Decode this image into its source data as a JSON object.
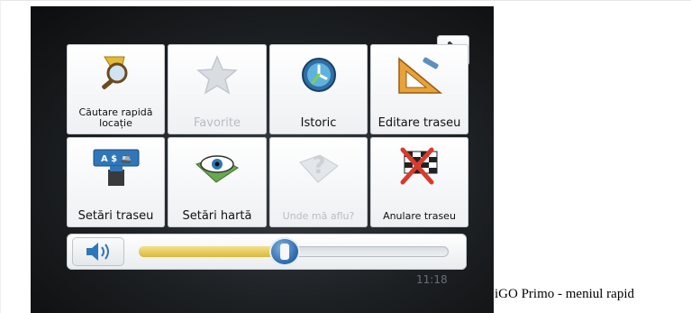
{
  "menu": {
    "tiles": [
      {
        "label": "Căutare rapidă locație",
        "icon": "search-pin-icon",
        "disabled": false
      },
      {
        "label": "Favorite",
        "icon": "star-icon",
        "disabled": true
      },
      {
        "label": "Istoric",
        "icon": "clock-icon",
        "disabled": false
      },
      {
        "label": "Editare traseu",
        "icon": "set-square-icon",
        "disabled": false
      },
      {
        "label": "Setări traseu",
        "icon": "route-settings-icon",
        "disabled": false
      },
      {
        "label": "Setări hartă",
        "icon": "map-eye-icon",
        "disabled": false
      },
      {
        "label": "Unde mă aflu?",
        "icon": "question-map-icon",
        "disabled": true
      },
      {
        "label": "Anulare traseu",
        "icon": "checkered-flag-icon",
        "disabled": false
      }
    ],
    "volume": {
      "level": 0.47
    },
    "next_page_icon": "chevron-right-icon"
  },
  "background": {
    "time_text": "11:18"
  },
  "caption": "iGO Primo - meniul rapid",
  "colors": {
    "accent_slider": "#e0c24a",
    "knob": "#2b67a8"
  }
}
